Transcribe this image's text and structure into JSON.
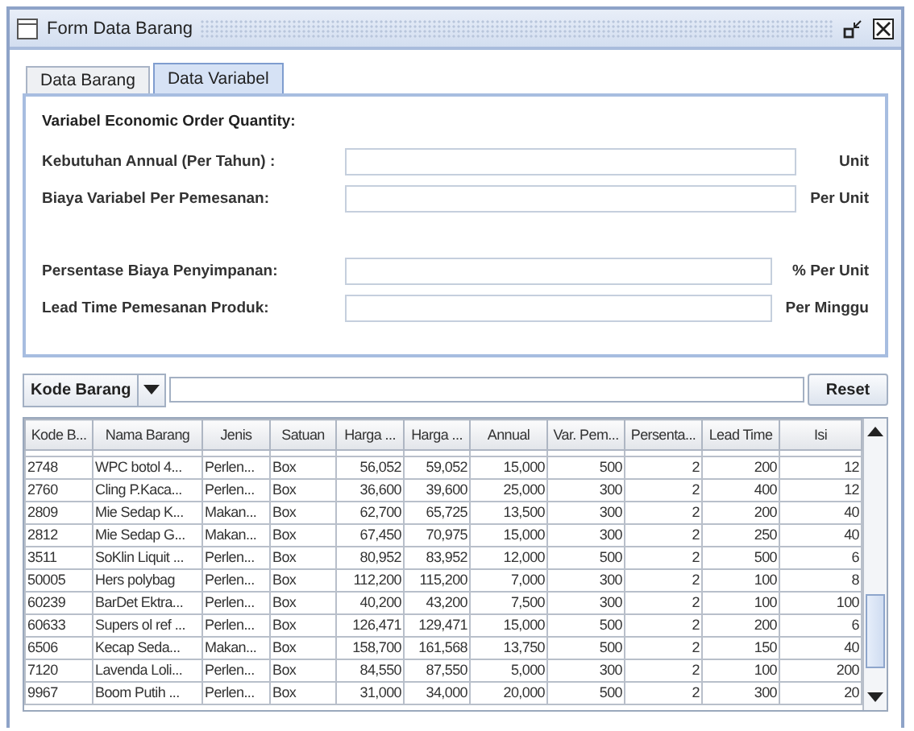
{
  "window": {
    "title": "Form Data Barang"
  },
  "tabs": [
    {
      "label": "Data Barang",
      "selected": false
    },
    {
      "label": "Data Variabel",
      "selected": true
    }
  ],
  "panel": {
    "heading": "Variabel Economic Order Quantity:",
    "fields": [
      {
        "label": "Kebutuhan Annual (Per Tahun) :",
        "unit": "Unit",
        "kind": "wide"
      },
      {
        "label": "Biaya Variabel Per Pemesanan:",
        "unit": "Per Unit",
        "kind": "wide"
      },
      {
        "label": "Persentase Biaya Penyimpanan:",
        "unit": "% Per Unit",
        "kind": "gap"
      },
      {
        "label": "Lead Time Pemesanan Produk:",
        "unit": "Per Minggu",
        "kind": "narrow"
      }
    ]
  },
  "filter": {
    "combo": "Kode Barang",
    "button": "Reset"
  },
  "table": {
    "columns": [
      "Kode B...",
      "Nama Barang",
      "Jenis",
      "Satuan",
      "Harga ...",
      "Harga ...",
      "Annual",
      "Var. Pem...",
      "Persenta...",
      "Lead Time",
      "Isi"
    ],
    "rows": [
      [
        "2748",
        "WPC botol 4...",
        "Perlen...",
        "Box",
        "56,052",
        "59,052",
        "15,000",
        "500",
        "2",
        "200",
        "12"
      ],
      [
        "2760",
        "Cling P.Kaca...",
        "Perlen...",
        "Box",
        "36,600",
        "39,600",
        "25,000",
        "300",
        "2",
        "400",
        "12"
      ],
      [
        "2809",
        "Mie Sedap K...",
        "Makan...",
        "Box",
        "62,700",
        "65,725",
        "13,500",
        "300",
        "2",
        "200",
        "40"
      ],
      [
        "2812",
        "Mie Sedap G...",
        "Makan...",
        "Box",
        "67,450",
        "70,975",
        "15,000",
        "300",
        "2",
        "250",
        "40"
      ],
      [
        "3511",
        "SoKlin Liquit ...",
        "Perlen...",
        "Box",
        "80,952",
        "83,952",
        "12,000",
        "500",
        "2",
        "500",
        "6"
      ],
      [
        "50005",
        "Hers polybag",
        "Perlen...",
        "Box",
        "112,200",
        "115,200",
        "7,000",
        "300",
        "2",
        "100",
        "8"
      ],
      [
        "60239",
        "BarDet Ektra...",
        "Perlen...",
        "Box",
        "40,200",
        "43,200",
        "7,500",
        "300",
        "2",
        "100",
        "100"
      ],
      [
        "60633",
        "Supers ol ref ...",
        "Perlen...",
        "Box",
        "126,471",
        "129,471",
        "15,000",
        "500",
        "2",
        "200",
        "6"
      ],
      [
        "6506",
        "Kecap Seda...",
        "Makan...",
        "Box",
        "158,700",
        "161,568",
        "13,750",
        "500",
        "2",
        "150",
        "40"
      ],
      [
        "7120",
        "Lavenda Loli...",
        "Perlen...",
        "Box",
        "84,550",
        "87,550",
        "5,000",
        "300",
        "2",
        "100",
        "200"
      ],
      [
        "9967",
        "Boom Putih ...",
        "Perlen...",
        "Box",
        "31,000",
        "34,000",
        "20,000",
        "500",
        "2",
        "300",
        "20"
      ]
    ]
  }
}
